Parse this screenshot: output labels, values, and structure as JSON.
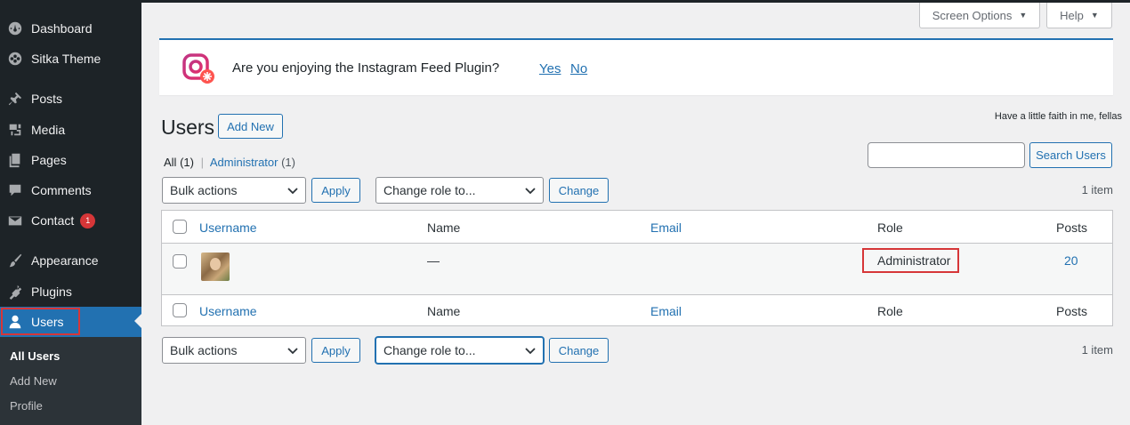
{
  "sidebar": {
    "items": [
      {
        "label": "Dashboard",
        "icon": "dashboard-icon"
      },
      {
        "label": "Sitka Theme",
        "icon": "theme-icon"
      },
      {
        "label": "Posts",
        "icon": "pin-icon"
      },
      {
        "label": "Media",
        "icon": "media-icon"
      },
      {
        "label": "Pages",
        "icon": "pages-icon"
      },
      {
        "label": "Comments",
        "icon": "comments-icon"
      },
      {
        "label": "Contact",
        "icon": "mail-icon",
        "badge": "1"
      },
      {
        "label": "Appearance",
        "icon": "brush-icon"
      },
      {
        "label": "Plugins",
        "icon": "plugin-icon"
      },
      {
        "label": "Users",
        "icon": "user-icon"
      }
    ],
    "submenu": [
      "All Users",
      "Add New",
      "Profile"
    ]
  },
  "header": {
    "screen_options": "Screen Options",
    "help": "Help"
  },
  "notice": {
    "question": "Are you enjoying the Instagram Feed Plugin?",
    "yes": "Yes",
    "no": "No"
  },
  "page": {
    "title": "Users",
    "add_new": "Add New",
    "quote": "Have a little faith in me, fellas",
    "views": {
      "all": "All",
      "all_count": "(1)",
      "separator": "|",
      "admin": "Administrator",
      "admin_count": "(1)"
    },
    "search_button": "Search Users",
    "search_value": "",
    "item_count": "1 item"
  },
  "controls": {
    "bulk_actions": "Bulk actions",
    "apply": "Apply",
    "change_role": "Change role to...",
    "change": "Change"
  },
  "table": {
    "columns": {
      "username": "Username",
      "name": "Name",
      "email": "Email",
      "role": "Role",
      "posts": "Posts"
    },
    "rows": [
      {
        "username": "",
        "name": "—",
        "email": "",
        "role": "Administrator",
        "posts": "20"
      }
    ]
  },
  "colors": {
    "accent": "#2271b1",
    "sidebar": "#1d2327",
    "highlight": "#d63638"
  }
}
